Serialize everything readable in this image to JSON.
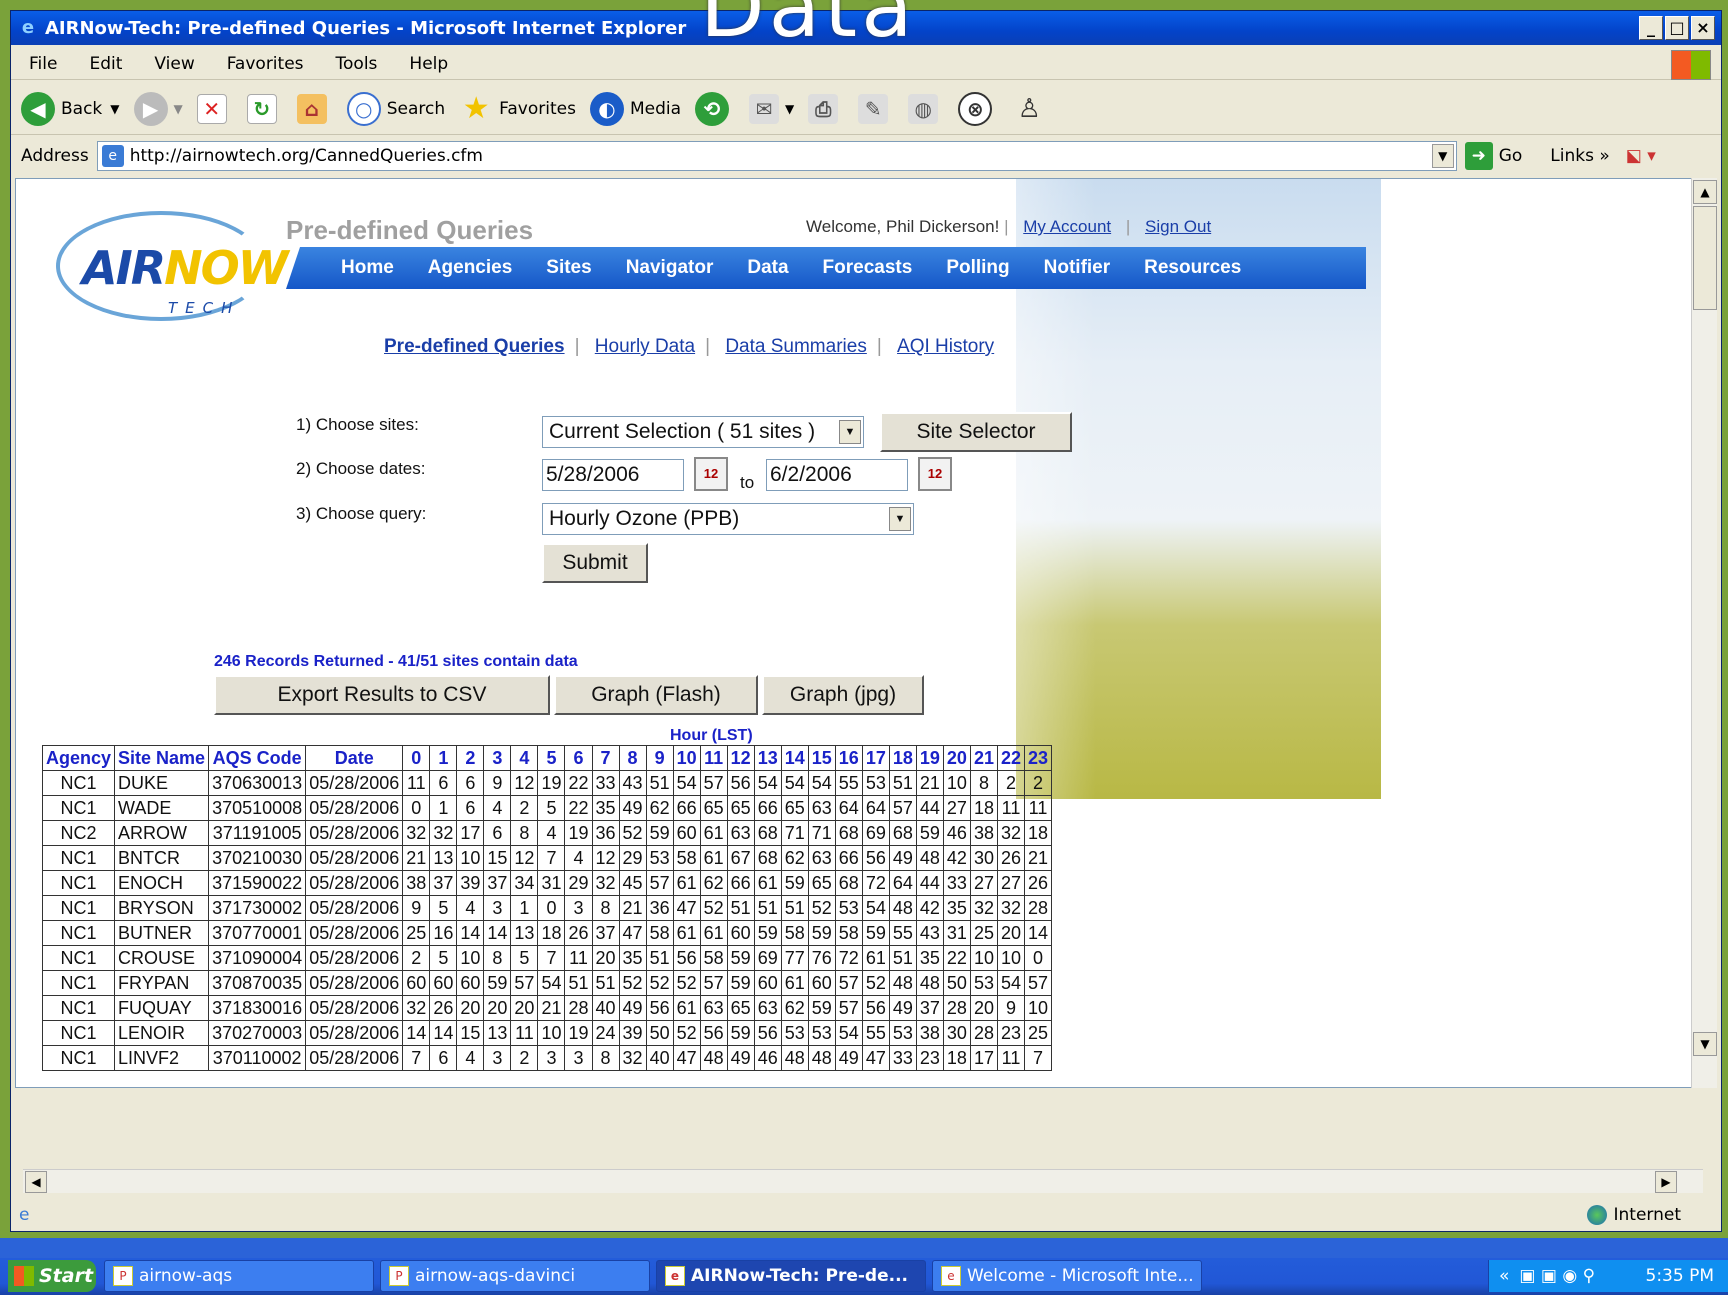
{
  "slide_title": "Data",
  "window": {
    "title": "AIRNow-Tech: Pre-defined Queries - Microsoft Internet Explorer"
  },
  "menu": [
    "File",
    "Edit",
    "View",
    "Favorites",
    "Tools",
    "Help"
  ],
  "toolbar": {
    "back": "Back",
    "search": "Search",
    "favorites": "Favorites",
    "media": "Media"
  },
  "address": {
    "label": "Address",
    "url": "http://airnowtech.org/CannedQueries.cfm",
    "go": "Go",
    "links": "Links"
  },
  "page": {
    "heading": "Pre-defined Queries",
    "welcome": "Welcome, Phil Dickerson!",
    "my_account": "My Account",
    "sign_out": "Sign Out",
    "logo_text": "AIRNOW",
    "logo_sub": "TECH",
    "nav": [
      "Home",
      "Agencies",
      "Sites",
      "Navigator",
      "Data",
      "Forecasts",
      "Polling",
      "Notifier",
      "Resources"
    ],
    "subnav": [
      "Pre-defined Queries",
      "Hourly Data",
      "Data Summaries",
      "AQI History"
    ],
    "form": {
      "label_sites": "1) Choose sites:",
      "label_dates": "2) Choose dates:",
      "label_query": "3) Choose query:",
      "sites_value": "Current Selection ( 51 sites )",
      "site_selector": "Site Selector",
      "date_from": "5/28/2006",
      "date_to": "6/2/2006",
      "to": "to",
      "query_value": "Hourly Ozone (PPB)",
      "submit": "Submit"
    },
    "records": "246 Records Returned - 41/51 sites contain data",
    "buttons": {
      "export": "Export Results to CSV",
      "graph_flash": "Graph (Flash)",
      "graph_jpg": "Graph (jpg)"
    },
    "hour_label": "Hour (LST)",
    "table": {
      "headers": [
        "Agency",
        "Site Name",
        "AQS Code",
        "Date",
        "0",
        "1",
        "2",
        "3",
        "4",
        "5",
        "6",
        "7",
        "8",
        "9",
        "10",
        "11",
        "12",
        "13",
        "14",
        "15",
        "16",
        "17",
        "18",
        "19",
        "20",
        "21",
        "22",
        "23"
      ],
      "rows": [
        [
          "NC1",
          "DUKE",
          "370630013",
          "05/28/2006",
          "11",
          "6",
          "6",
          "9",
          "12",
          "19",
          "22",
          "33",
          "43",
          "51",
          "54",
          "57",
          "56",
          "54",
          "54",
          "54",
          "55",
          "53",
          "51",
          "21",
          "10",
          "8",
          "2",
          "2"
        ],
        [
          "NC1",
          "WADE",
          "370510008",
          "05/28/2006",
          "0",
          "1",
          "6",
          "4",
          "2",
          "5",
          "22",
          "35",
          "49",
          "62",
          "66",
          "65",
          "65",
          "66",
          "65",
          "63",
          "64",
          "64",
          "57",
          "44",
          "27",
          "18",
          "11",
          "11"
        ],
        [
          "NC2",
          "ARROW",
          "371191005",
          "05/28/2006",
          "32",
          "32",
          "17",
          "6",
          "8",
          "4",
          "19",
          "36",
          "52",
          "59",
          "60",
          "61",
          "63",
          "68",
          "71",
          "71",
          "68",
          "69",
          "68",
          "59",
          "46",
          "38",
          "32",
          "18"
        ],
        [
          "NC1",
          "BNTCR",
          "370210030",
          "05/28/2006",
          "21",
          "13",
          "10",
          "15",
          "12",
          "7",
          "4",
          "12",
          "29",
          "53",
          "58",
          "61",
          "67",
          "68",
          "62",
          "63",
          "66",
          "56",
          "49",
          "48",
          "42",
          "30",
          "26",
          "21"
        ],
        [
          "NC1",
          "ENOCH",
          "371590022",
          "05/28/2006",
          "38",
          "37",
          "39",
          "37",
          "34",
          "31",
          "29",
          "32",
          "45",
          "57",
          "61",
          "62",
          "66",
          "61",
          "59",
          "65",
          "68",
          "72",
          "64",
          "44",
          "33",
          "27",
          "27",
          "26"
        ],
        [
          "NC1",
          "BRYSON",
          "371730002",
          "05/28/2006",
          "9",
          "5",
          "4",
          "3",
          "1",
          "0",
          "3",
          "8",
          "21",
          "36",
          "47",
          "52",
          "51",
          "51",
          "51",
          "52",
          "53",
          "54",
          "48",
          "42",
          "35",
          "32",
          "32",
          "28"
        ],
        [
          "NC1",
          "BUTNER",
          "370770001",
          "05/28/2006",
          "25",
          "16",
          "14",
          "14",
          "13",
          "18",
          "26",
          "37",
          "47",
          "58",
          "61",
          "61",
          "60",
          "59",
          "58",
          "59",
          "58",
          "59",
          "55",
          "43",
          "31",
          "25",
          "20",
          "14"
        ],
        [
          "NC1",
          "CROUSE",
          "371090004",
          "05/28/2006",
          "2",
          "5",
          "10",
          "8",
          "5",
          "7",
          "11",
          "20",
          "35",
          "51",
          "56",
          "58",
          "59",
          "69",
          "77",
          "76",
          "72",
          "61",
          "51",
          "35",
          "22",
          "10",
          "10",
          "0"
        ],
        [
          "NC1",
          "FRYPAN",
          "370870035",
          "05/28/2006",
          "60",
          "60",
          "60",
          "59",
          "57",
          "54",
          "51",
          "51",
          "52",
          "52",
          "52",
          "57",
          "59",
          "60",
          "61",
          "60",
          "57",
          "52",
          "48",
          "48",
          "50",
          "53",
          "54",
          "57"
        ],
        [
          "NC1",
          "FUQUAY",
          "371830016",
          "05/28/2006",
          "32",
          "26",
          "20",
          "20",
          "20",
          "21",
          "28",
          "40",
          "49",
          "56",
          "61",
          "63",
          "65",
          "63",
          "62",
          "59",
          "57",
          "56",
          "49",
          "37",
          "28",
          "20",
          "9",
          "10"
        ],
        [
          "NC1",
          "LENOIR",
          "370270003",
          "05/28/2006",
          "14",
          "14",
          "15",
          "13",
          "11",
          "10",
          "19",
          "24",
          "39",
          "50",
          "52",
          "56",
          "59",
          "56",
          "53",
          "53",
          "54",
          "55",
          "53",
          "38",
          "30",
          "28",
          "23",
          "25"
        ],
        [
          "NC1",
          "LINVF2",
          "370110002",
          "05/28/2006",
          "7",
          "6",
          "4",
          "3",
          "2",
          "3",
          "3",
          "8",
          "32",
          "40",
          "47",
          "48",
          "49",
          "46",
          "48",
          "48",
          "49",
          "47",
          "33",
          "23",
          "18",
          "17",
          "11",
          "7"
        ]
      ]
    }
  },
  "status": {
    "zone": "Internet"
  },
  "taskbar": {
    "start": "Start",
    "tasks": [
      "airnow-aqs",
      "airnow-aqs-davinci",
      "AIRNow-Tech: Pre-de...",
      "Welcome - Microsoft Inte..."
    ],
    "clock": "5:35 PM"
  }
}
